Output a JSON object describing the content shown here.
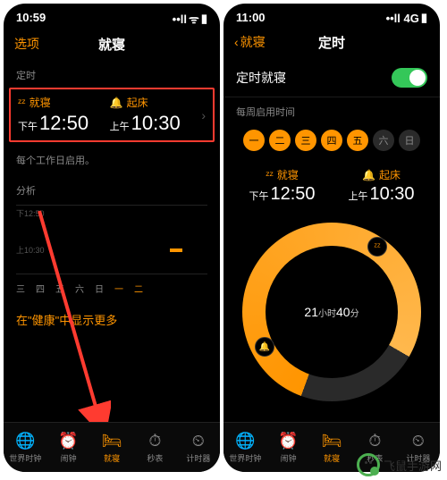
{
  "p1": {
    "status": {
      "time": "10:59",
      "signal": "••ll",
      "wifi": "ᯤ",
      "batt": "▮"
    },
    "nav": {
      "left": "选项",
      "title": "就寝"
    },
    "sect_timer": "定时",
    "bed": {
      "label": "就寝",
      "pre": "下午",
      "val": "12:50"
    },
    "wake": {
      "label": "起床",
      "pre": "上午",
      "val": "10:30"
    },
    "note": "每个工作日启用。",
    "sect_analysis": "分析",
    "y1": "下12:50",
    "y2": "上10:30",
    "days": [
      "三",
      "四",
      "五",
      "六",
      "日",
      "一",
      "二"
    ],
    "link": "在\"健康\"中显示更多",
    "tabs": [
      {
        "icon": "🌐",
        "label": "世界时钟"
      },
      {
        "icon": "⏰",
        "label": "闹钟"
      },
      {
        "icon": "🛏",
        "label": "就寝"
      },
      {
        "icon": "⏱",
        "label": "秒表"
      },
      {
        "icon": "⏲",
        "label": "计时器"
      }
    ]
  },
  "p2": {
    "status": {
      "time": "11:00",
      "net": "••ll 4G",
      "batt": "▮"
    },
    "nav": {
      "back": "就寝",
      "title": "定时"
    },
    "enable": "定时就寝",
    "sect_week": "每周启用时间",
    "week": [
      "一",
      "二",
      "三",
      "四",
      "五",
      "六",
      "日"
    ],
    "bed": {
      "label": "就寝",
      "pre": "下午",
      "val": "12:50"
    },
    "wake": {
      "label": "起床",
      "pre": "上午",
      "val": "10:30"
    },
    "dur": {
      "h": "21",
      "hl": "小时",
      "m": "40",
      "ml": "分"
    }
  },
  "watermark": "飞鼠手游网"
}
